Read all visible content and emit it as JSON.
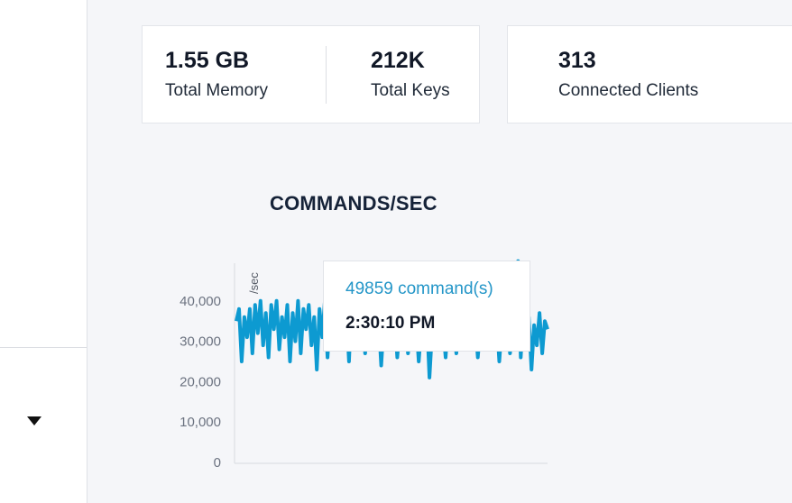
{
  "stats": {
    "total_memory": {
      "value": "1.55 GB",
      "label": "Total Memory"
    },
    "total_keys": {
      "value": "212K",
      "label": "Total Keys"
    },
    "connected_clients": {
      "value": "313",
      "label": "Connected Clients"
    }
  },
  "sidebar": {
    "caret_icon": "caret-down-icon"
  },
  "chart": {
    "title": "COMMANDS/SEC",
    "y_axis_title": "/sec",
    "tooltip": {
      "value": "49859 command(s)",
      "time": "2:30:10 PM"
    }
  },
  "colors": {
    "series": "#0d9ad1",
    "tooltip_value": "#2496c8",
    "background": "#f5f6f9"
  },
  "chart_data": {
    "type": "line",
    "title": "COMMANDS/SEC",
    "ylabel": "/sec",
    "ylim": [
      0,
      50000
    ],
    "yticks": [
      "0",
      "10,000",
      "20,000",
      "30,000",
      "40,000"
    ],
    "grid": false,
    "series": [
      {
        "values": [
          35000,
          38000,
          25000,
          36000,
          31000,
          38000,
          27000,
          39000,
          32000,
          40000,
          29000,
          37000,
          26000,
          39000,
          33000,
          40000,
          28000,
          36000,
          31000,
          39000,
          25000,
          37000,
          30000,
          40000,
          27000,
          38000,
          33000,
          39000,
          29000,
          36000,
          23000,
          38000,
          31000,
          40000,
          26000,
          37000,
          33000,
          39000,
          28000,
          36000,
          31000,
          38000,
          25000,
          41000,
          30000,
          36000,
          33000,
          39000,
          27000,
          37000,
          31000,
          38000,
          28000,
          36000,
          24000,
          35000,
          31000,
          37000,
          28000,
          36000,
          26000,
          34000,
          30000,
          36000,
          27000,
          33000,
          31000,
          35000,
          25000,
          34000,
          29000,
          36000,
          21000,
          33000,
          28000,
          35000,
          30000,
          34000,
          26000,
          36000,
          29000,
          34000,
          27000,
          35000,
          31000,
          36000,
          28000,
          33000,
          30000,
          35000,
          26000,
          34000,
          29000,
          37000,
          28000,
          35000,
          31000,
          36000,
          25000,
          34000,
          30000,
          37000,
          27000,
          35000,
          32000,
          49859,
          26000,
          38000,
          31000,
          36000,
          23000,
          34000,
          29000,
          37000,
          27000,
          35000,
          33000
        ]
      }
    ]
  }
}
